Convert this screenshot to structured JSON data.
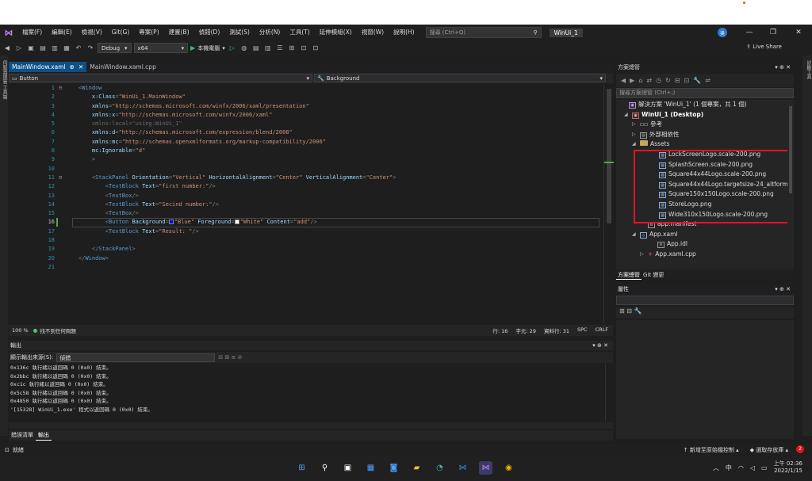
{
  "menu": [
    "檔案(F)",
    "編輯(E)",
    "檢視(V)",
    "Git(G)",
    "專案(P)",
    "建置(B)",
    "偵錯(D)",
    "測試(S)",
    "分析(N)",
    "工具(T)",
    "延伸模組(X)",
    "視窗(W)",
    "說明(H)"
  ],
  "search": {
    "placeholder": "搜尋 (Ctrl+Q)"
  },
  "solution_name": "WinUi_1",
  "avatar": "吳",
  "toolbar": {
    "config": "Debug",
    "platform": "x64",
    "run_label": "本機電腦",
    "live_share": "Live Share"
  },
  "side_labels": {
    "left": "伺服器總管 工具箱",
    "right": "診斷工具"
  },
  "tabs": [
    {
      "label": "MainWindow.xaml",
      "active": true
    },
    {
      "label": "MainWindow.xaml.cpp",
      "active": false
    }
  ],
  "nav": {
    "left": "Button",
    "right": "Background"
  },
  "code_lines": [
    {
      "n": "1",
      "html": "<span class='t-punc'>&lt;</span><span class='t-tag'>Window</span>"
    },
    {
      "n": "2",
      "html": "    <span class='t-attr'>x:Class</span><span class='t-punc'>=</span><span class='t-val'>\"WinUi_1.MainWindow\"</span>"
    },
    {
      "n": "3",
      "html": "    <span class='t-attr'>xmlns</span><span class='t-punc'>=</span><span class='t-val'>\"http://schemas.microsoft.com/winfx/2006/xaml/presentation\"</span>"
    },
    {
      "n": "4",
      "html": "    <span class='t-attr'>xmlns:x</span><span class='t-punc'>=</span><span class='t-val'>\"http://schemas.microsoft.com/winfx/2006/xaml\"</span>"
    },
    {
      "n": "5",
      "html": "    <span class='t-dim'>xmlns:local=\"using:WinUi_1\"</span>"
    },
    {
      "n": "6",
      "html": "    <span class='t-attr'>xmlns:d</span><span class='t-punc'>=</span><span class='t-val'>\"http://schemas.microsoft.com/expression/blend/2008\"</span>"
    },
    {
      "n": "7",
      "html": "    <span class='t-attr'>xmlns:mc</span><span class='t-punc'>=</span><span class='t-val'>\"http://schemas.openxmlformats.org/markup-compatibility/2006\"</span>"
    },
    {
      "n": "8",
      "html": "    <span class='t-attr'>mc:Ignorable</span><span class='t-punc'>=</span><span class='t-val'>\"d\"</span>"
    },
    {
      "n": "9",
      "html": "    <span class='t-punc'>&gt;</span>"
    },
    {
      "n": "10",
      "html": ""
    },
    {
      "n": "11",
      "html": "    <span class='t-punc'>&lt;</span><span class='t-tag'>StackPanel</span> <span class='t-attr'>Orientation</span><span class='t-punc'>=</span><span class='t-val'>\"Vertical\"</span> <span class='t-attr'>HorizontalAlignment</span><span class='t-punc'>=</span><span class='t-val'>\"Center\"</span> <span class='t-attr'>VerticalAlignment</span><span class='t-punc'>=</span><span class='t-val'>\"Center\"</span><span class='t-punc'>&gt;</span>"
    },
    {
      "n": "12",
      "html": "        <span class='t-punc'>&lt;</span><span class='t-tag'>TextBlock</span> <span class='t-attr'>Text</span><span class='t-punc'>=</span><span class='t-val'>\"first number:\"</span><span class='t-punc'>/&gt;</span>"
    },
    {
      "n": "13",
      "html": "        <span class='t-punc'>&lt;</span><span class='t-tag'>TextBox</span><span class='t-punc'>/&gt;</span>"
    },
    {
      "n": "14",
      "html": "        <span class='t-punc'>&lt;</span><span class='t-tag'>TextBlock</span> <span class='t-attr'>Text</span><span class='t-punc'>=</span><span class='t-val'>\"Secind number:\"</span><span class='t-punc'>/&gt;</span>"
    },
    {
      "n": "15",
      "html": "        <span class='t-punc'>&lt;</span><span class='t-tag'>TextBox</span><span class='t-punc'>/&gt;</span>"
    },
    {
      "n": "16",
      "html": "        <span class='t-punc'>&lt;</span><span class='t-tag'>Button</span> <span class='t-attr'>Background</span><span class='t-punc'>=</span><span class='sw' style='background:#0000ff'></span><span class='t-val'>\"Blue\"</span> <span class='t-attr'>Foreground</span><span class='t-punc'>=</span><span class='sw' style='background:#ffffff'></span><span class='t-val'>\"White\"</span> <span class='t-attr'>Content</span><span class='t-punc'>=</span><span class='t-val'>\"add\"</span><span class='t-punc'>/&gt;</span>",
      "current": true
    },
    {
      "n": "17",
      "html": "        <span class='t-punc'>&lt;</span><span class='t-tag'>TextBlock</span> <span class='t-attr'>Text</span><span class='t-punc'>=</span><span class='t-val'>\"Result: \"</span><span class='t-punc'>/&gt;</span>"
    },
    {
      "n": "18",
      "html": ""
    },
    {
      "n": "19",
      "html": "    <span class='t-punc'>&lt;/</span><span class='t-tag'>StackPanel</span><span class='t-punc'>&gt;</span>"
    },
    {
      "n": "20",
      "html": "<span class='t-punc'>&lt;/</span><span class='t-tag'>Window</span><span class='t-punc'>&gt;</span>"
    },
    {
      "n": "21",
      "html": ""
    }
  ],
  "editor_status": {
    "zoom": "100 %",
    "issues": "找不到任何問題",
    "line": "行: 16",
    "char": "字元: 29",
    "col": "資料行: 31",
    "spc": "SPC",
    "crlf": "CRLF"
  },
  "output": {
    "title": "輸出",
    "source_label": "顯示輸出來源(S):",
    "source_value": "偵錯",
    "lines": [
      "0x136c 執行緒以返回碼 0 (0x0) 結束。",
      "0x2bbc 執行緒以返回碼 0 (0x0) 結束。",
      "0xc1c 執行緒以返回碼 0 (0x0) 結束。",
      "0x5c58 執行緒以返回碼 0 (0x0) 結束。",
      "0x4850 執行緒以返回碼 0 (0x0) 結束。",
      "'[15328] WinUi_1.exe' 程式以返回碼 0 (0x0) 結束。"
    ],
    "tabs": [
      "錯誤清單",
      "輸出"
    ]
  },
  "solution_explorer": {
    "title": "方案總管",
    "search_placeholder": "搜尋方案總管 (Ctrl+;)",
    "nodes": [
      {
        "label": "解決方案 'WinUi_1' (1 個專案，共 1 個)",
        "icon": "solution"
      },
      {
        "label": "WinUi_1 (Desktop)",
        "icon": "project",
        "bold": true
      },
      {
        "label": "參考",
        "icon": "references"
      },
      {
        "label": "外部相依性",
        "icon": "external"
      },
      {
        "label": "Assets",
        "icon": "folder"
      },
      {
        "label": "LockScreenLogo.scale-200.png",
        "icon": "image"
      },
      {
        "label": "SplashScreen.scale-200.png",
        "icon": "image"
      },
      {
        "label": "Square44x44Logo.scale-200.png",
        "icon": "image"
      },
      {
        "label": "Square44x44Logo.targetsize-24_altform-u",
        "icon": "image"
      },
      {
        "label": "Square150x150Logo.scale-200.png",
        "icon": "image"
      },
      {
        "label": "StoreLogo.png",
        "icon": "image"
      },
      {
        "label": "Wide310x150Logo.scale-200.png",
        "icon": "image"
      },
      {
        "label": "app.manifest",
        "icon": "file"
      },
      {
        "label": "App.xaml",
        "icon": "xaml"
      },
      {
        "label": "App.idl",
        "icon": "file"
      },
      {
        "label": "App.xaml.cpp",
        "icon": "cpp"
      }
    ],
    "tabs": [
      "方案總管",
      "Git 變更"
    ]
  },
  "properties": {
    "title": "屬性"
  },
  "statusbar": {
    "left": "就緒",
    "source_control": "新增至原始檔控制",
    "repo": "選取存放庫",
    "bell": "2"
  },
  "taskbar": {
    "ime": "中",
    "time": "上午 02:36",
    "date": "2022/1/15"
  }
}
